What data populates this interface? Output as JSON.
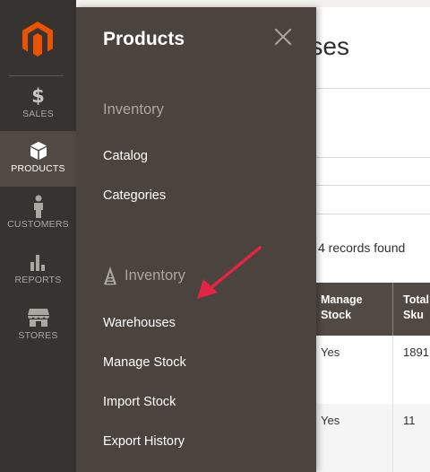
{
  "colors": {
    "sidebar_bg": "#373330",
    "sidebar_active_bg": "#514943",
    "panel_bg": "#4a433e",
    "brand_orange": "#eb5202",
    "arrow_red": "#e22544",
    "grid_header_bg": "#514943"
  },
  "sidebar": {
    "logo_icon": "magento-logo-icon",
    "items": [
      {
        "label": "SALES",
        "icon": "dollar-icon",
        "active": false
      },
      {
        "label": "PRODUCTS",
        "icon": "cube-icon",
        "active": true
      },
      {
        "label": "CUSTOMERS",
        "icon": "person-icon",
        "active": false
      },
      {
        "label": "REPORTS",
        "icon": "bar-chart-icon",
        "active": false
      },
      {
        "label": "STORES",
        "icon": "store-icon",
        "active": false
      }
    ]
  },
  "panel": {
    "title": "Products",
    "close_icon": "close-icon",
    "sections": [
      {
        "title": "Inventory",
        "icon": null,
        "links": [
          "Catalog",
          "Categories"
        ]
      },
      {
        "title": "Inventory",
        "icon": "warehouse-a-icon",
        "links": [
          "Warehouses",
          "Manage Stock",
          "Import Stock",
          "Export History"
        ]
      }
    ]
  },
  "page": {
    "title_visible": "ses",
    "records_found": "4 records found",
    "grid": {
      "columns": [
        "Manage\nStock",
        "Total\nSku"
      ],
      "rows": [
        {
          "manage_stock": "Yes",
          "total_sku": "1891"
        },
        {
          "manage_stock": "Yes",
          "total_sku": "11"
        }
      ]
    }
  }
}
